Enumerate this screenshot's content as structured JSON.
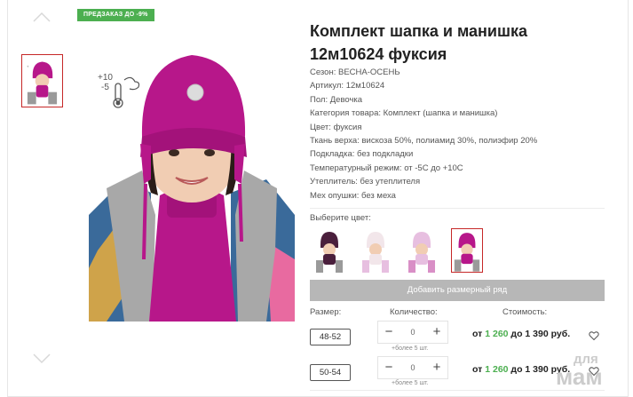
{
  "badge": "ПРЕДЗАКАЗ ДО -9%",
  "temperature_icon": {
    "top": "+10",
    "bottom": "-5"
  },
  "product": {
    "title_line1": "Комплект шапка и манишка",
    "title_line2": "12м10624 фуксия",
    "specs": [
      "Сезон: ВЕСНА-ОСЕНЬ",
      "Артикул: 12м10624",
      "Пол: Девочка",
      "Категория товара: Комплект (шапка и манишка)",
      "Цвет: фуксия",
      "Ткань верха: вискоза 50%, полиамид 30%, полиэфир 20%",
      "Подкладка: без подкладки",
      "Температурный режим: от -5С до +10С",
      "Утеплитель: без утеплителя",
      "Мех опушки: без меха"
    ]
  },
  "color_choice": {
    "label": "Выберите цвет:",
    "swatches": [
      {
        "color": "#4a1f3c",
        "selected": false
      },
      {
        "color": "#f2e6ea",
        "selected": false
      },
      {
        "color": "#e7bfe0",
        "selected": false
      },
      {
        "color": "#b7178a",
        "selected": true
      }
    ]
  },
  "add_button": "Добавить размерный ряд",
  "table": {
    "header_size": "Размер:",
    "header_qty": "Количество:",
    "header_cost": "Стоимость:",
    "rows": [
      {
        "size": "48-52",
        "qty": "0",
        "more": "+более 5 шт.",
        "price_from": "от",
        "price_low": "1 260",
        "price_to": "до 1 390 руб."
      },
      {
        "size": "50-54",
        "qty": "0",
        "more": "+более 5 шт.",
        "price_from": "от",
        "price_low": "1 260",
        "price_to": "до 1 390 руб."
      }
    ]
  },
  "qty_minus": "−",
  "qty_plus": "+",
  "icons": [
    "chevron-up-icon",
    "chevron-down-icon",
    "thermometer-icon",
    "heart-icon"
  ],
  "watermark": {
    "line1": "для",
    "line2": "мам"
  },
  "colors": {
    "accent_green": "#4caf50",
    "selected_border": "#c62828",
    "button_gray": "#b7b7b7",
    "product_fuchsia": "#b7178a"
  }
}
